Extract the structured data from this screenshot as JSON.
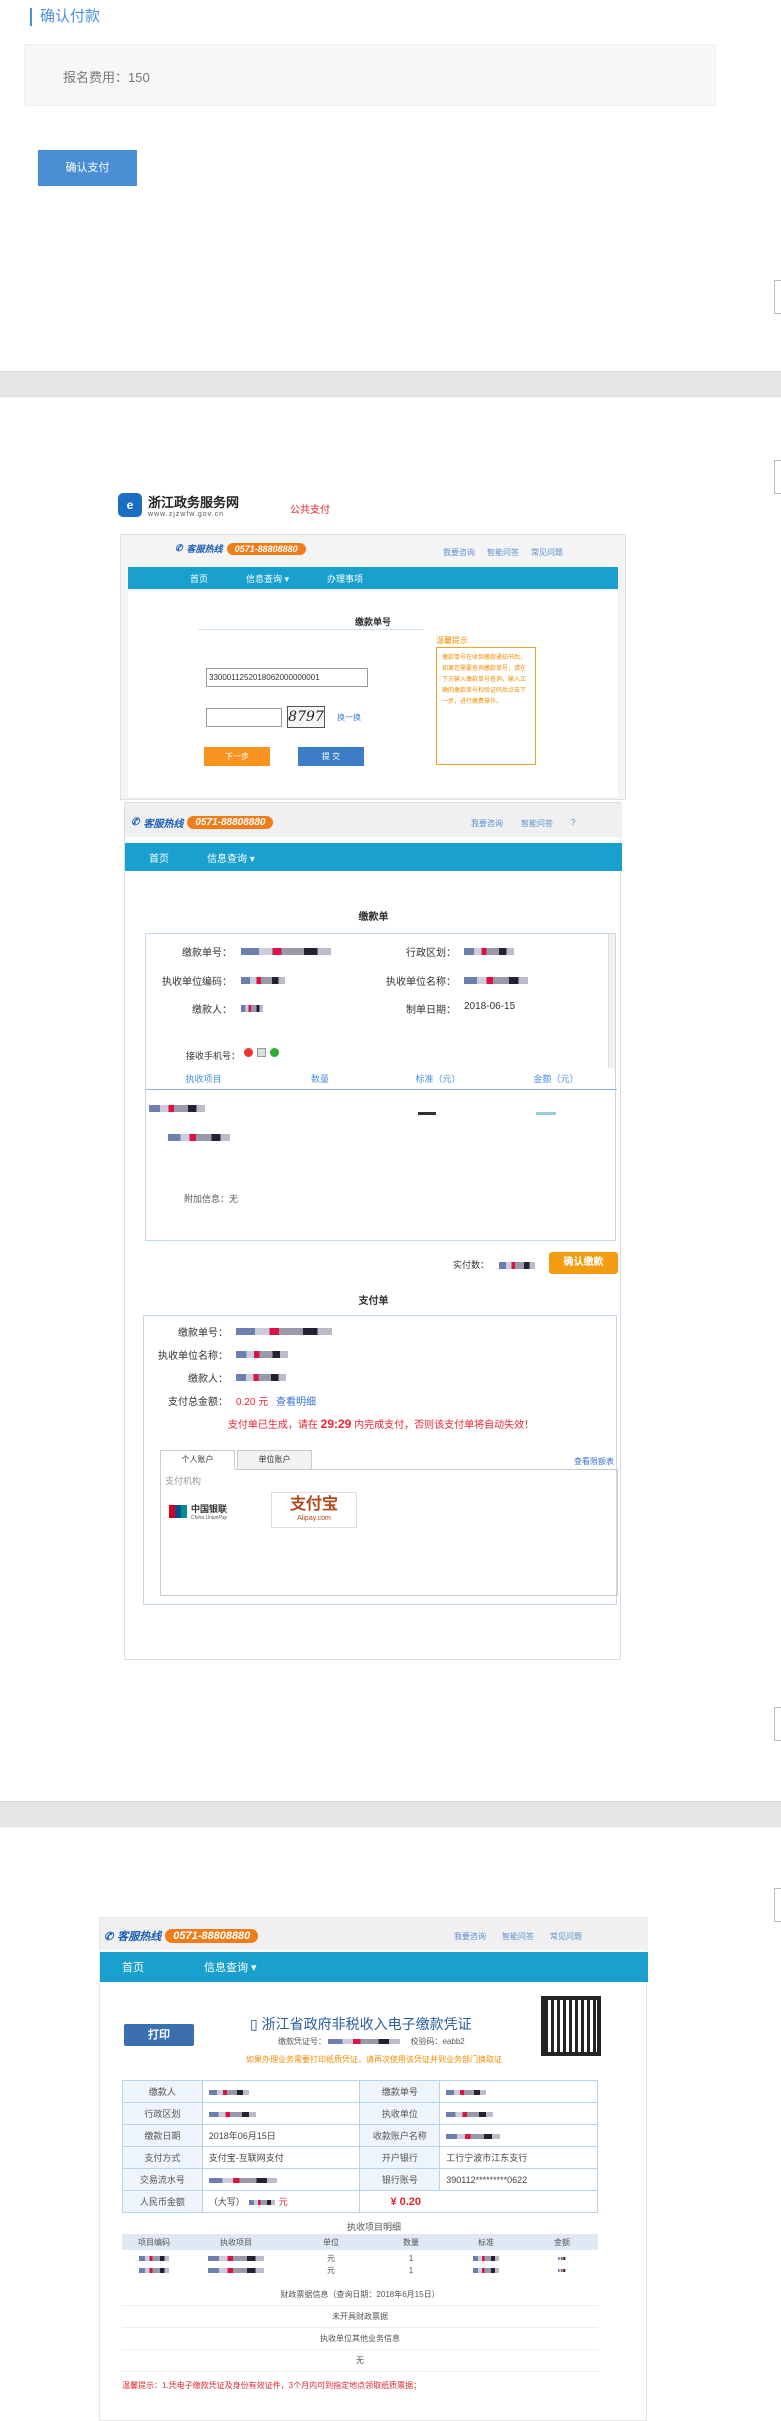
{
  "section1": {
    "title": "确认付款",
    "fee_text": "报名费用：150",
    "confirm_button": "确认支付"
  },
  "portal": {
    "site_name": "浙江政务服务网",
    "site_url": "www.zjzwfw.gov.cn",
    "public_pay": "公共支付",
    "hotline_label": "客服热线",
    "hotline_number": "0571-88808880",
    "top_links": [
      "我要咨询",
      "智能问答",
      "常见问题"
    ],
    "nav": [
      "首页",
      "信息查询 ▾",
      "办理事项"
    ],
    "form_title": "缴款单号",
    "bill_number_value": "3300011252018062000000001",
    "captcha_value": "8797",
    "refresh_captcha": "换一换",
    "next_button": "下一步",
    "submit_button": "提 交",
    "tips_title": "温馨提示",
    "tips_text": "缴款单号在收到缴款通知书后，如果您需要查询缴款单号，请在下方输入缴款单号查询，输入正确的缴款单号和验证码后点击下一步，进行缴费操作。"
  },
  "payment_page": {
    "hotline_label": "客服热线",
    "hotline_number": "0571-88808880",
    "top_links": [
      "我要咨询",
      "智能问答"
    ],
    "nav": [
      "首页",
      "信息查询 ▾"
    ],
    "bill_title": "缴款单",
    "fields_left": [
      {
        "label": "缴款单号："
      },
      {
        "label": "执收单位编码："
      },
      {
        "label": "缴款人："
      }
    ],
    "fields_right": [
      {
        "label": "行政区划：",
        "value": ""
      },
      {
        "label": "执收单位名称：",
        "value": ""
      },
      {
        "label": "制单日期：",
        "value": "2018-06-15"
      }
    ],
    "phone_label": "接收手机号：",
    "item_headers": [
      "执收项目",
      "数量",
      "标准（元）",
      "金额（元）"
    ],
    "extra_info": "附加信息：无",
    "amount_due_label": "实付数：",
    "confirm_pay": "确认缴款",
    "pay_title": "支付单",
    "pay_fields": [
      "缴款单号：",
      "执收单位名称：",
      "缴款人：",
      "支付总金额："
    ],
    "total_amount": "0.20 元",
    "view_detail": "查看明细",
    "countdown_prefix": "支付单已生成，请在",
    "countdown_time": "29:29",
    "countdown_suffix": "内完成支付，否则该支付单将自动失效！",
    "tabs": [
      "个人账户",
      "单位账户"
    ],
    "bank_help": "查看限额表",
    "pay_org_label": "支付机构",
    "unionpay_name": "中国银联",
    "unionpay_en": "China UnionPay",
    "alipay_name": "支付宝",
    "alipay_en": "Alipay.com"
  },
  "receipt": {
    "hotline_label": "客服热线",
    "hotline_number": "0571-88808880",
    "top_links": [
      "我要咨询",
      "智能问答",
      "常见问题"
    ],
    "nav": [
      "首页",
      "信息查询 ▾"
    ],
    "print_button": "打印",
    "title": "浙江省政府非税收入电子缴款凭证",
    "voucher_label": "缴款凭证号：",
    "check_code": "校验码：eabb2",
    "warning": "如果办理业务需要打印纸质凭证，请再次使用该凭证并到业务部门换取证",
    "rows": [
      [
        "缴款人",
        "",
        "缴款单号",
        ""
      ],
      [
        "行政区划",
        "",
        "执收单位",
        ""
      ],
      [
        "缴款日期",
        "2018年06月15日",
        "收款账户名称",
        ""
      ],
      [
        "支付方式",
        "支付宝-互联网支付",
        "开户银行",
        "工行宁波市江东支行"
      ],
      [
        "交易流水号",
        "",
        "银行账号",
        "390112*********0622"
      ]
    ],
    "rmb_label": "人民币金额",
    "rmb_capital": "（大写）",
    "rmb_unit": "元",
    "rmb_amount": "¥ 0.20",
    "items_title": "执收项目明细",
    "item_headers": [
      "项目编码",
      "执收项目",
      "单位",
      "数量",
      "标准",
      "金额"
    ],
    "item_rows": [
      [
        "",
        "",
        "元",
        "1",
        "",
        ""
      ],
      [
        "",
        "",
        "元",
        "1",
        "",
        ""
      ]
    ],
    "finance_info": "财政票据信息（查询日期：2018年6月15日）",
    "no_finance": "未开具财政票据",
    "unit_info": "执收单位其他业务信息",
    "none": "无",
    "footer_tip": "温馨提示：1.凭电子缴款凭证及身份有效证件，3个月内可到指定地点领取纸质票据；"
  }
}
